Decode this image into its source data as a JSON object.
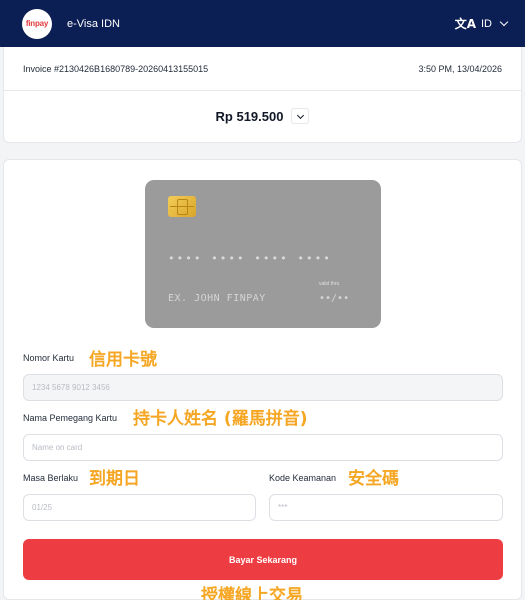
{
  "header": {
    "logo_text": "finpay",
    "title": "e-Visa IDN",
    "language_icon": "translate-icon",
    "language": "ID"
  },
  "summary": {
    "invoice": "Invoice #2130426B1680789-20260413155015",
    "datetime": "3:50 PM, 13/04/2026",
    "amount": "Rp 519.500"
  },
  "card_preview": {
    "number_mask": "•••• •••• •••• ••••",
    "holder_placeholder": "EX. JOHN FINPAY",
    "valid_thru_label": "valid thru",
    "expiry_mask": "••/••"
  },
  "form": {
    "card_number": {
      "label": "Nomor Kartu",
      "annotation": "信用卡號",
      "placeholder": "1234 5678 9012 3456"
    },
    "holder_name": {
      "label": "Nama Pemegang Kartu",
      "annotation": "持卡人姓名 (羅馬拼音)",
      "placeholder": "Name on card"
    },
    "expiry": {
      "label": "Masa Berlaku",
      "annotation": "到期日",
      "placeholder": "01/25"
    },
    "cvv": {
      "label": "Kode Keamanan",
      "annotation": "安全碼",
      "placeholder": "***"
    },
    "pay_button": "Bayar Sekarang",
    "pay_annotation": "授權線上交易"
  },
  "colors": {
    "header_bg": "#0c1f55",
    "accent_red": "#ee3d42",
    "annotation": "#f5a623",
    "card_bg": "#9b9b9b"
  }
}
